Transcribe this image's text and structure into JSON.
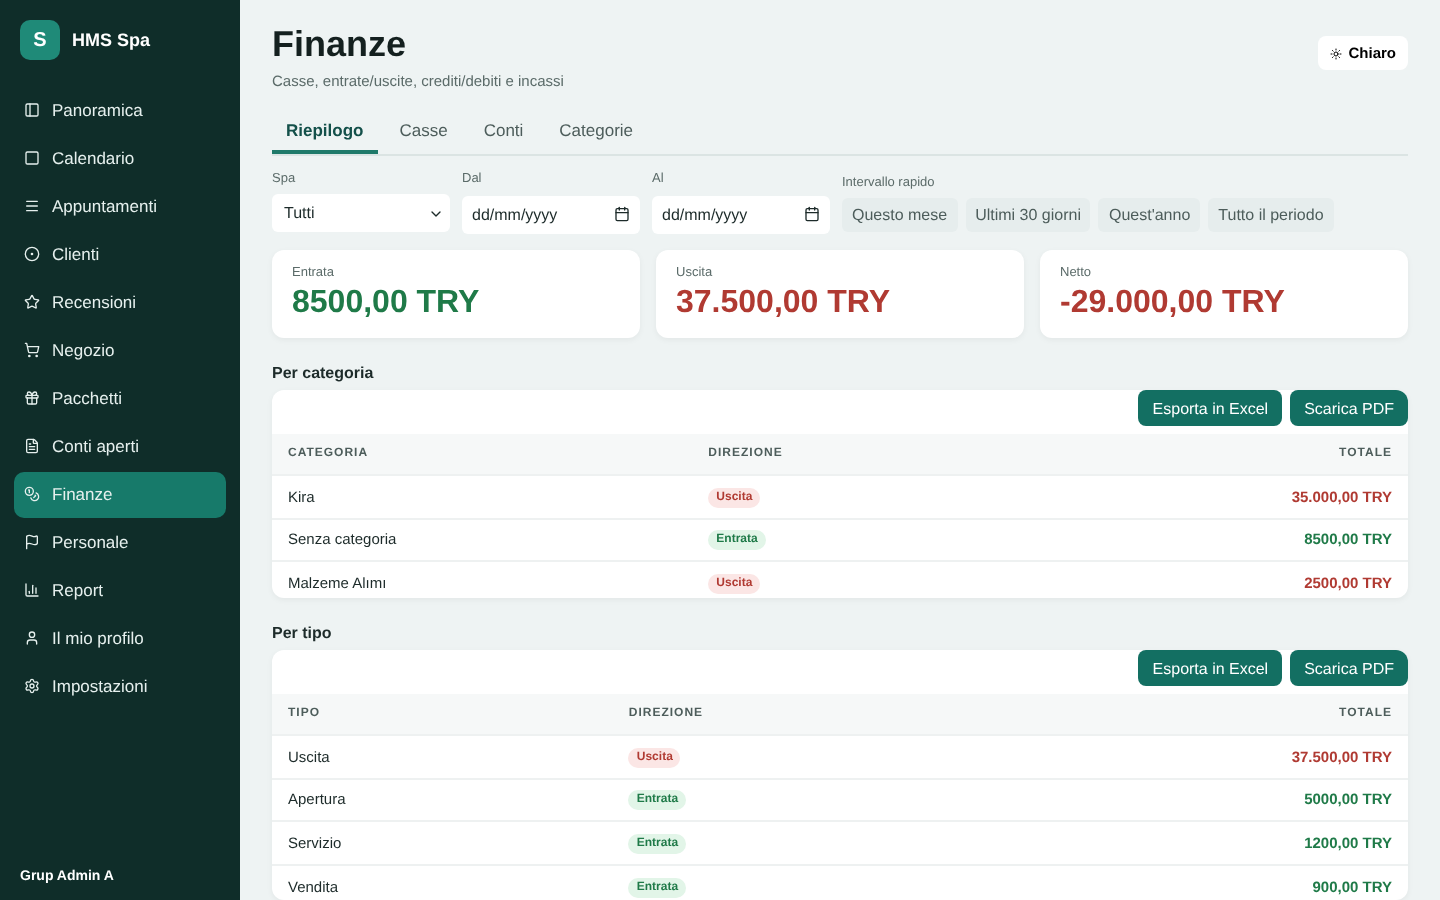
{
  "brand": {
    "initial": "S",
    "name": "HMS Spa"
  },
  "sidebar": {
    "items": [
      {
        "label": "Panoramica",
        "selected": false
      },
      {
        "label": "Calendario",
        "selected": false
      },
      {
        "label": "Appuntamenti",
        "selected": false
      },
      {
        "label": "Clienti",
        "selected": false
      },
      {
        "label": "Recensioni",
        "selected": false
      },
      {
        "label": "Negozio",
        "selected": false
      },
      {
        "label": "Pacchetti",
        "selected": false
      },
      {
        "label": "Conti aperti",
        "selected": false
      },
      {
        "label": "Finanze",
        "selected": true
      },
      {
        "label": "Personale",
        "selected": false
      },
      {
        "label": "Report",
        "selected": false
      },
      {
        "label": "Il mio profilo",
        "selected": false
      },
      {
        "label": "Impostazioni",
        "selected": false
      }
    ],
    "footer": "Grup Admin A"
  },
  "header": {
    "title": "Finanze",
    "subtitle": "Casse, entrate/uscite, crediti/debiti e incassi",
    "theme_button": "Chiaro"
  },
  "tabs": [
    {
      "label": "Riepilogo",
      "selected": true
    },
    {
      "label": "Casse",
      "selected": false
    },
    {
      "label": "Conti",
      "selected": false
    },
    {
      "label": "Categorie",
      "selected": false
    }
  ],
  "filters": {
    "spa": {
      "label": "Spa",
      "value": "Tutti"
    },
    "from": {
      "label": "Dal",
      "placeholder": "dd/mm/yyyy"
    },
    "to": {
      "label": "Al",
      "placeholder": "dd/mm/yyyy"
    },
    "quick": {
      "label": "Intervallo rapido",
      "options": [
        "Questo mese",
        "Ultimi 30 giorni",
        "Quest'anno",
        "Tutto il periodo"
      ]
    }
  },
  "summary": [
    {
      "label": "Entrata",
      "value": "8500,00 TRY",
      "kind": "in"
    },
    {
      "label": "Uscita",
      "value": "37.500,00 TRY",
      "kind": "out"
    },
    {
      "label": "Netto",
      "value": "-29.000,00 TRY",
      "kind": "out"
    }
  ],
  "sections": [
    {
      "title": "Per categoria",
      "buttons": [
        "Esporta in Excel",
        "Scarica PDF"
      ],
      "columns": [
        "CATEGORIA",
        "DIREZIONE",
        "TOTALE"
      ],
      "rows": [
        {
          "name": "Kira",
          "direction": "Uscita",
          "total": "35.000,00 TRY",
          "kind": "out"
        },
        {
          "name": "Senza categoria",
          "direction": "Entrata",
          "total": "8500,00 TRY",
          "kind": "in"
        },
        {
          "name": "Malzeme Alımı",
          "direction": "Uscita",
          "total": "2500,00 TRY",
          "kind": "out"
        }
      ]
    },
    {
      "title": "Per tipo",
      "buttons": [
        "Esporta in Excel",
        "Scarica PDF"
      ],
      "columns": [
        "TIPO",
        "DIREZIONE",
        "TOTALE"
      ],
      "rows": [
        {
          "name": "Uscita",
          "direction": "Uscita",
          "total": "37.500,00 TRY",
          "kind": "out"
        },
        {
          "name": "Apertura",
          "direction": "Entrata",
          "total": "5000,00 TRY",
          "kind": "in"
        },
        {
          "name": "Servizio",
          "direction": "Entrata",
          "total": "1200,00 TRY",
          "kind": "in"
        },
        {
          "name": "Vendita",
          "direction": "Entrata",
          "total": "900,00 TRY",
          "kind": "in"
        }
      ]
    }
  ]
}
